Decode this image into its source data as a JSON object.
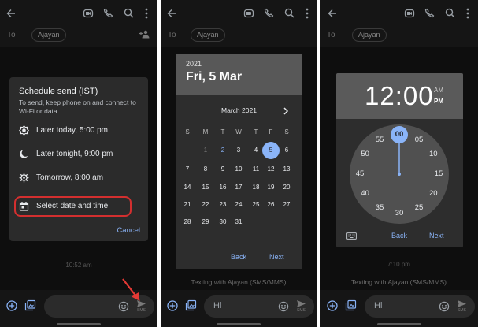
{
  "panel1": {
    "chip": "Ajayan",
    "to_label": "To",
    "dialog": {
      "title": "Schedule send (IST)",
      "description": "To send, keep phone on and connect to Wi-Fi or data",
      "options": [
        {
          "label": "Later today, 5:00 pm",
          "icon": "brightness-icon"
        },
        {
          "label": "Later tonight, 9:00 pm",
          "icon": "moon-icon"
        },
        {
          "label": "Tomorrow, 8:00 am",
          "icon": "gear-icon"
        },
        {
          "label": "Select date and time",
          "icon": "calendar-icon"
        }
      ],
      "cancel": "Cancel"
    },
    "timestamp": "10:52 am",
    "sms_label": "SMS"
  },
  "panel2": {
    "chip": "Ajayan",
    "to_label": "To",
    "picker": {
      "year": "2021",
      "date": "Fri, 5 Mar",
      "month": "March 2021",
      "weekdays": [
        "S",
        "M",
        "T",
        "W",
        "T",
        "F",
        "S"
      ],
      "days": [
        "1",
        "2",
        "3",
        "4",
        "5",
        "6",
        "7",
        "8",
        "9",
        "10",
        "11",
        "12",
        "13",
        "14",
        "15",
        "16",
        "17",
        "18",
        "19",
        "20",
        "21",
        "22",
        "23",
        "24",
        "25",
        "26",
        "27",
        "28",
        "29",
        "30",
        "31"
      ],
      "selected_day": "5",
      "today_day": "2",
      "back": "Back",
      "next": "Next"
    },
    "subtitle": "Texting with Ajayan (SMS/MMS)",
    "compose_text": "Hi",
    "sms_label": "SMS"
  },
  "panel3": {
    "chip": "Ajayan",
    "to_label": "To",
    "picker": {
      "hour": "12",
      "colon": ":",
      "minute": "00",
      "am": "AM",
      "pm": "PM",
      "numbers": [
        "00",
        "05",
        "10",
        "15",
        "20",
        "25",
        "30",
        "35",
        "40",
        "45",
        "50",
        "55"
      ],
      "selected": "00",
      "back": "Back",
      "next": "Next"
    },
    "timestamp": "7:10 pm",
    "subtitle": "Texting with Ajayan (SMS/MMS)",
    "compose_text": "Hi",
    "sms_label": "SMS"
  },
  "colors": {
    "accent": "#8ab4f8",
    "highlight": "#d32f2f",
    "arrow": "#e53935"
  }
}
